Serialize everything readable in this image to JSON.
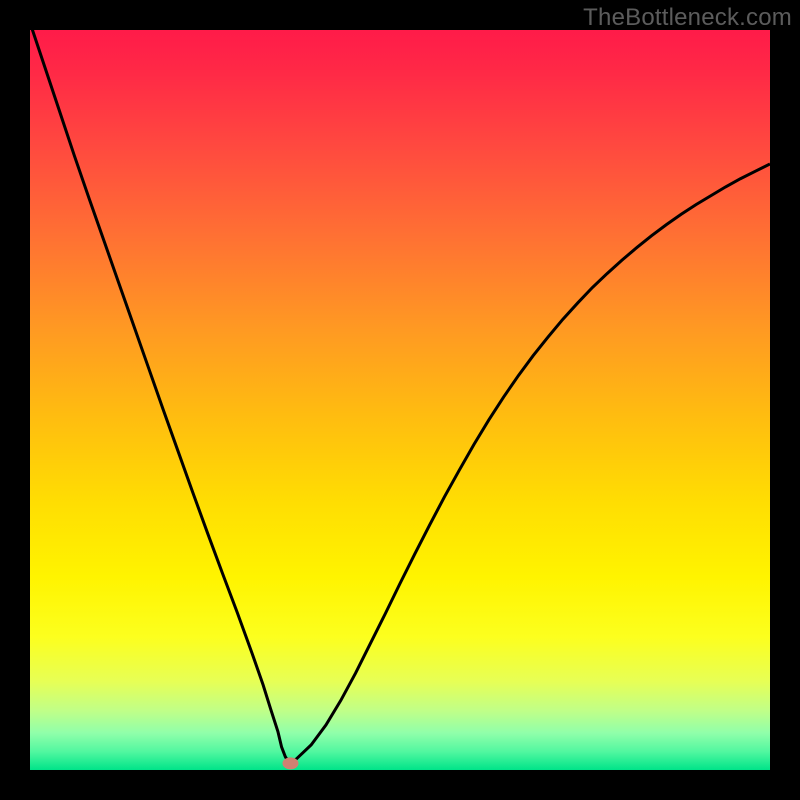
{
  "watermark": "TheBottleneck.com",
  "chart_data": {
    "type": "line",
    "title": "",
    "xlabel": "",
    "ylabel": "",
    "xlim": [
      0,
      100
    ],
    "ylim": [
      0,
      100
    ],
    "x": [
      0,
      2,
      4,
      6,
      8,
      10,
      12,
      14,
      16,
      18,
      20,
      22,
      24,
      26,
      28,
      30,
      31.5,
      32.5,
      33.5,
      34,
      34.5,
      35,
      35.2,
      36,
      38,
      40,
      42,
      44,
      46,
      48,
      50,
      52,
      54,
      56,
      58,
      60,
      62,
      64,
      66,
      68,
      70,
      72,
      74,
      76,
      78,
      80,
      82,
      84,
      86,
      88,
      90,
      92,
      94,
      96,
      98,
      100
    ],
    "y": [
      101,
      95,
      89,
      83,
      77.2,
      71.5,
      65.8,
      60.1,
      54.4,
      48.7,
      43.1,
      37.5,
      32,
      26.6,
      21.3,
      15.8,
      11.5,
      8.3,
      5.2,
      3.1,
      1.8,
      1,
      0.9,
      1.5,
      3.4,
      6.1,
      9.4,
      13.1,
      17.1,
      21.1,
      25.2,
      29.2,
      33.1,
      36.9,
      40.5,
      44,
      47.3,
      50.4,
      53.3,
      56,
      58.5,
      60.9,
      63.1,
      65.2,
      67.1,
      68.9,
      70.6,
      72.2,
      73.7,
      75.1,
      76.4,
      77.6,
      78.8,
      79.9,
      80.9,
      81.9
    ],
    "marker": {
      "x": 35.2,
      "y": 0.9
    },
    "gradient_stops": [
      {
        "pos": 0.0,
        "color": "#ff1b49"
      },
      {
        "pos": 0.06,
        "color": "#ff2a46"
      },
      {
        "pos": 0.16,
        "color": "#ff4a3f"
      },
      {
        "pos": 0.28,
        "color": "#ff7133"
      },
      {
        "pos": 0.4,
        "color": "#ff9823"
      },
      {
        "pos": 0.52,
        "color": "#ffbc10"
      },
      {
        "pos": 0.64,
        "color": "#ffde02"
      },
      {
        "pos": 0.74,
        "color": "#fff400"
      },
      {
        "pos": 0.82,
        "color": "#fcff1e"
      },
      {
        "pos": 0.88,
        "color": "#e7ff55"
      },
      {
        "pos": 0.92,
        "color": "#c0ff88"
      },
      {
        "pos": 0.95,
        "color": "#90ffaa"
      },
      {
        "pos": 0.975,
        "color": "#52f7a0"
      },
      {
        "pos": 1.0,
        "color": "#00e489"
      }
    ],
    "marker_color": "#cf8172",
    "curve_color": "#000000"
  }
}
